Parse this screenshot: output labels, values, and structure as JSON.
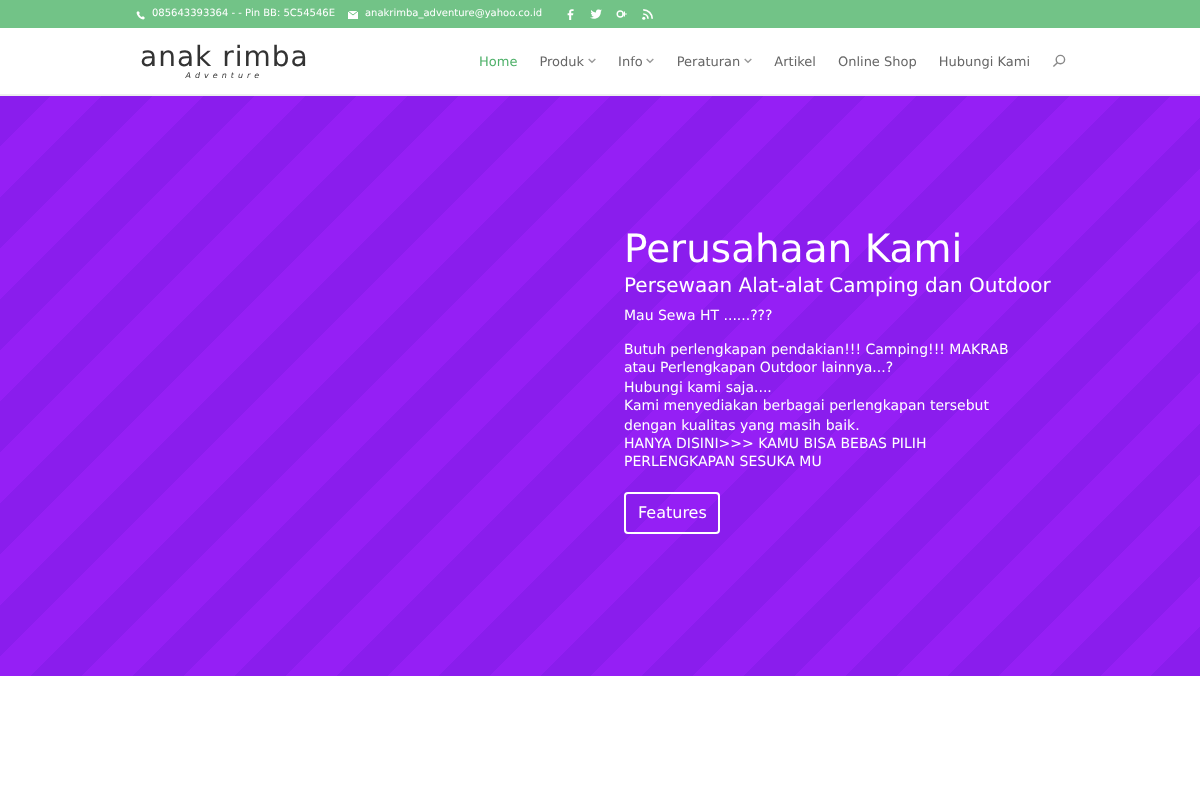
{
  "top_bar": {
    "phone": "085643393364 - - Pin BB: 5C54546E",
    "email": "anakrimba_adventure@yahoo.co.id"
  },
  "logo": {
    "name": "anak rimba",
    "tagline": "Adventure"
  },
  "nav": [
    {
      "label": "Home",
      "selected": true,
      "has_menu": false
    },
    {
      "label": "Produk",
      "selected": false,
      "has_menu": true
    },
    {
      "label": "Info",
      "selected": false,
      "has_menu": true
    },
    {
      "label": "Peraturan",
      "selected": false,
      "has_menu": true
    },
    {
      "label": "Artikel",
      "selected": false,
      "has_menu": false
    },
    {
      "label": "Online Shop",
      "selected": false,
      "has_menu": false
    },
    {
      "label": "Hubungi Kami",
      "selected": false,
      "has_menu": false
    }
  ],
  "hero": {
    "title": "Perusahaan Kami",
    "subtitle": "Persewaan Alat-alat Camping dan Outdoor",
    "note": "Mau Sewa HT ......???",
    "lines": [
      "Butuh perlengkapan pendakian!!! Camping!!! MAKRAB",
      "atau Perlengkapan Outdoor lainnya...?",
      "Hubungi kami saja....",
      "Kami menyediakan berbagai perlengkapan tersebut",
      "dengan kualitas yang masih baik.",
      "HANYA DISINI>>> KAMU BISA BEBAS PILIH",
      "PERLENGKAPAN SESUKA MU"
    ],
    "button": "Features"
  }
}
